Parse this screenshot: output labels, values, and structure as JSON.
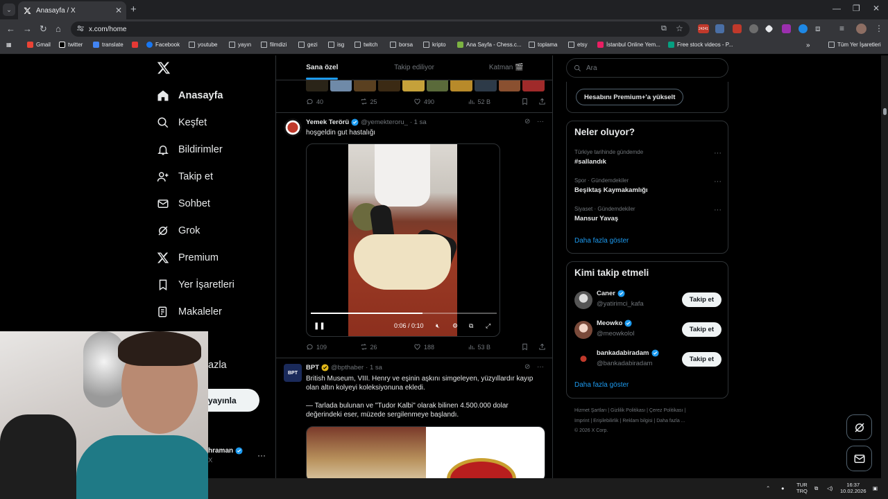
{
  "browser": {
    "tab_title": "Anasayfa / X",
    "url": "x.com/home",
    "extension_badge": "24241",
    "bookmarks": [
      "Gmail",
      "twitter",
      "translate",
      "",
      "Facebook",
      "youtube",
      "yayın",
      "filmdizi",
      "gezi",
      "isg",
      "twitch",
      "borsa",
      "kripto",
      "Ana Sayfa - Chess.c...",
      "toplama",
      "etsy",
      "İstanbul Online Yem...",
      "Free stock videos - P..."
    ],
    "all_bookmarks": "Tüm Yer İşaretleri"
  },
  "sidebar": {
    "items": [
      {
        "label": "Anasayfa",
        "icon": "home-icon"
      },
      {
        "label": "Keşfet",
        "icon": "search-icon"
      },
      {
        "label": "Bildirimler",
        "icon": "bell-icon"
      },
      {
        "label": "Takip et",
        "icon": "follow-icon"
      },
      {
        "label": "Sohbet",
        "icon": "mail-icon"
      },
      {
        "label": "Grok",
        "icon": "grok-icon"
      },
      {
        "label": "Premium",
        "icon": "x-icon"
      },
      {
        "label": "Yer İşaretleri",
        "icon": "bookmark-icon"
      },
      {
        "label": "Makaleler",
        "icon": "articles-icon"
      }
    ],
    "more_label_partial": "azla",
    "post_button_partial": "yayınla",
    "account_name_partial": "hraman",
    "account_handle_partial": "X"
  },
  "feed": {
    "tabs": [
      "Sana özel",
      "Takip ediliyor",
      "Katman 🎬"
    ],
    "prev_actions": {
      "replies": "40",
      "reposts": "25",
      "likes": "490",
      "views": "52 B"
    },
    "tweet1": {
      "name": "Yemek Terörü",
      "handle": "@yemekteroru_",
      "time": "· 1 sa",
      "text": "hoşgeldin gut hastalığı",
      "video_time": "0:06 / 0:10",
      "video_progress": 0.6,
      "actions": {
        "replies": "109",
        "reposts": "26",
        "likes": "188",
        "views": "53 B"
      }
    },
    "tweet2": {
      "name": "BPT",
      "handle": "@bpthaber",
      "time": "· 1 sa",
      "avatar_text": "BPT",
      "text1": "British Museum, VIII. Henry ve eşinin aşkını simgeleyen, yüzyıllardır kayıp olan altın kolyeyi koleksiyonuna ekledi.",
      "text2": "— Tarlada bulunan ve \"Tudor Kalbi\" olarak bilinen 4.500.000 dolar değerindeki eser, müzede sergilenmeye başlandı."
    }
  },
  "right": {
    "search_placeholder": "Ara",
    "premium_button": "Hesabını Premium+'a yükselt",
    "trends_title": "Neler oluyor?",
    "trends": [
      {
        "context": "Türkiye tarihinde gündemde",
        "title": "#sallandık"
      },
      {
        "context": "Spor · Gündemdekiler",
        "title": "Beşiktaş Kaymakamlığı"
      },
      {
        "context": "Siyaset · Gündemdekiler",
        "title": "Mansur Yavaş"
      }
    ],
    "show_more": "Daha fazla göster",
    "who_title": "Kimi takip etmeli",
    "who": [
      {
        "name": "Caner",
        "handle": "@yatirimci_kafa",
        "button": "Takip et"
      },
      {
        "name": "Meowko",
        "handle": "@meowkolol",
        "button": "Takip et"
      },
      {
        "name": "bankadabiradam",
        "handle": "@bankadabiradam",
        "button": "Takip et"
      }
    ],
    "who_more": "Daha fazla göster",
    "footer_line1": "Hizmet Şartları  |  Gizlilik Politikası  |  Çerez Politikası  |",
    "footer_line2": "Imprint  |  Erişilebilirlik  |  Reklam bilgisi  |  Daha fazla ...",
    "footer_line3": "© 2026 X Corp."
  },
  "taskbar": {
    "lang1": "TUR",
    "lang2": "TRQ",
    "time": "16:37",
    "date": "10.02.2026"
  },
  "colors": {
    "accent": "#1d9bf0",
    "bg": "#000000",
    "border": "#2f3336",
    "muted": "#71767b"
  }
}
